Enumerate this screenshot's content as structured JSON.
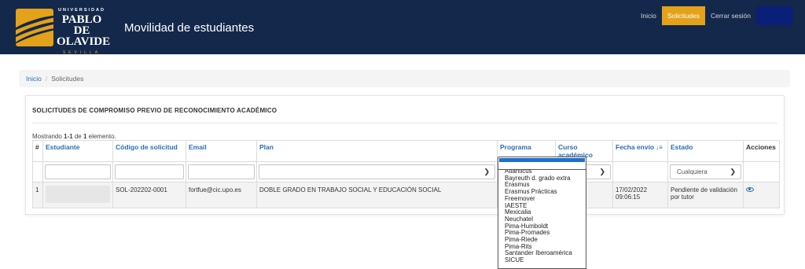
{
  "header": {
    "logo": {
      "universidad": "UNIVERSIDAD",
      "pablo": "PABLO DE",
      "olavide": "OLAVIDE",
      "sevilla": "SEVILLA"
    },
    "app_title": "Movilidad de estudiantes",
    "nav": [
      {
        "label": "Inicio",
        "active": false
      },
      {
        "label": "Solicitudes",
        "active": true
      },
      {
        "label": "Cerrar sesión",
        "active": false
      }
    ]
  },
  "breadcrumb": {
    "home": "Inicio",
    "separator": "/",
    "current": "Solicitudes"
  },
  "panel": {
    "title": "SOLICITUDES DE COMPROMISO PREVIO DE RECONOCIMIENTO ACADÉMICO",
    "summary": {
      "prefix": "Mostrando ",
      "range": "1-1",
      "middle": " de ",
      "total": "1",
      "suffix": " elemento."
    }
  },
  "table": {
    "columns": [
      "#",
      "Estudiante",
      "Código de solicitud",
      "Email",
      "Plan",
      "Programa",
      "Curso académico",
      "Fecha envío",
      "Estado",
      "Acciones"
    ],
    "estado_filter_value": "Cualquiera",
    "rows": [
      {
        "num": "1",
        "estudiante": "",
        "codigo": "SOL-202202-0001",
        "email": "fortfue@cic.upo.es",
        "plan": "DOBLE GRADO EN TRABAJO SOCIAL Y EDUCACIÓN SOCIAL",
        "programa": "",
        "curso": "",
        "fecha_line1": "17/02/2022",
        "fecha_line2": "09:06:15",
        "estado": "Pendiente de validación por tutor"
      }
    ]
  },
  "programa_dropdown": {
    "options": [
      "Atlanticus",
      "Bayreuth d. grado extra",
      "Erasmus",
      "Erasmus Prácticas",
      "Freemover",
      "IAESTE",
      "Mexicalia",
      "Neuchatel",
      "Pima-Humboldt",
      "Pima-Promades",
      "Pima-Riede",
      "Pima-Rits",
      "Santander Iberoamérica",
      "SICUE"
    ]
  },
  "colors": {
    "navy": "#13284a",
    "gold": "#e3a21a",
    "link": "#2a6db4"
  },
  "icons": {
    "sort": "sort-desc-icon",
    "view": "eye-icon",
    "chevron": "chevron-down-icon"
  }
}
